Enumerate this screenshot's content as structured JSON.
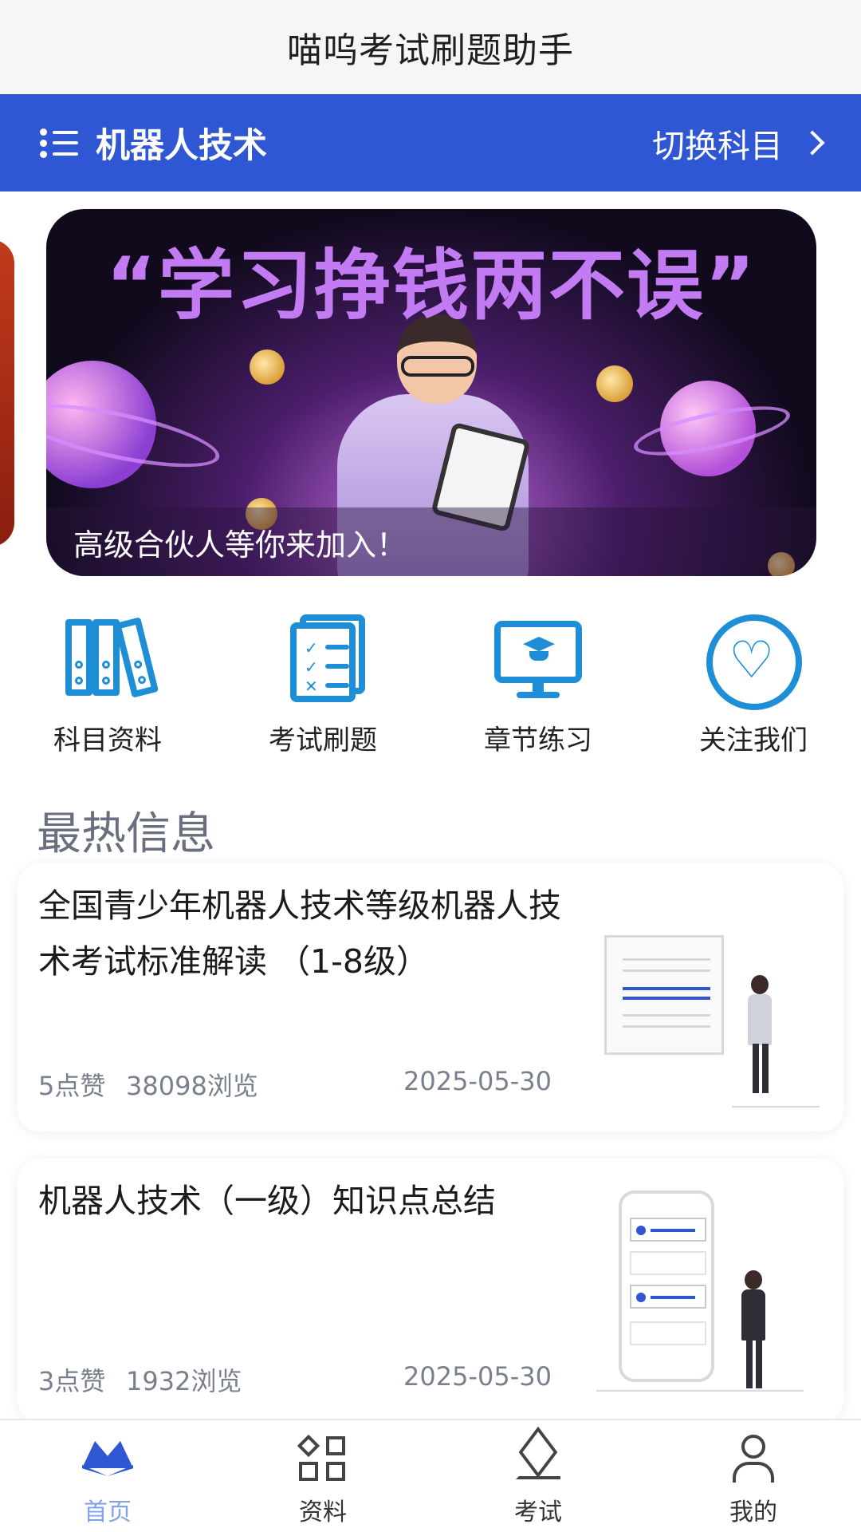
{
  "header": {
    "title": "喵呜考试刷题助手"
  },
  "subject_bar": {
    "subject": "机器人技术",
    "switch_label": "切换科目"
  },
  "banner": {
    "headline": "“学习挣钱两不误”",
    "caption": "高级合伙人等你来加入！"
  },
  "quick_actions": [
    {
      "label": "科目资料",
      "icon": "binders-icon"
    },
    {
      "label": "考试刷题",
      "icon": "checklist-icon"
    },
    {
      "label": "章节练习",
      "icon": "graduation-monitor-icon"
    },
    {
      "label": "关注我们",
      "icon": "heart-icon"
    }
  ],
  "hot": {
    "title": "最热信息",
    "items": [
      {
        "title": "全国青少年机器人技术等级机器人技术考试标准解读 （1-8级）",
        "likes": "5点赞",
        "views": "38098浏览",
        "date": "2025-05-30"
      },
      {
        "title": "机器人技术（一级）知识点总结",
        "likes": "3点赞",
        "views": "1932浏览",
        "date": "2025-05-30"
      }
    ]
  },
  "bottom_nav": [
    {
      "label": "首页",
      "icon": "home-icon",
      "active": true
    },
    {
      "label": "资料",
      "icon": "grid-icon",
      "active": false
    },
    {
      "label": "考试",
      "icon": "layers-icon",
      "active": false
    },
    {
      "label": "我的",
      "icon": "user-icon",
      "active": false
    }
  ],
  "colors": {
    "primary": "#2f57d3",
    "icon_blue": "#1e8fd6",
    "active_tab": "#7fa4e8"
  }
}
